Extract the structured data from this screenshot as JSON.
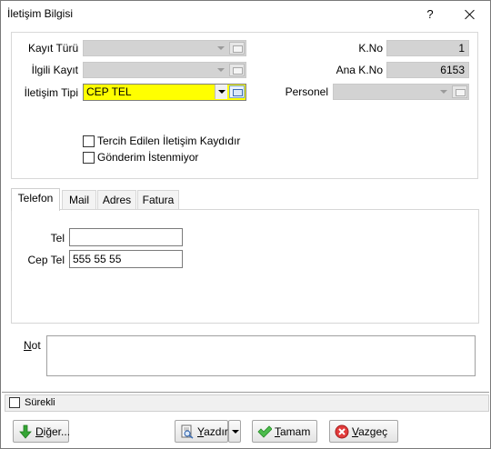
{
  "window": {
    "title": "İletişim Bilgisi",
    "help": "?"
  },
  "form": {
    "kayit_turu_label": "Kayıt Türü",
    "ilgili_kayit_label": "İlgili Kayıt",
    "iletisim_tipi_label": "İletişim Tipi",
    "iletisim_tipi_value": "CEP TEL",
    "kno_label": "K.No",
    "kno_value": "1",
    "ana_kno_label": "Ana K.No",
    "ana_kno_value": "6153",
    "personel_label": "Personel",
    "tercih_label": "Tercih Edilen İletişim Kaydıdır",
    "gonderim_label": "Gönderim İstenmiyor"
  },
  "tabs": [
    {
      "label": "Telefon"
    },
    {
      "label": "Mail"
    },
    {
      "label": "Adres"
    },
    {
      "label": "Fatura"
    }
  ],
  "phone": {
    "tel_label": "Tel",
    "tel_value": "",
    "cep_tel_label": "Cep Tel",
    "cep_tel_value": "555 55 55"
  },
  "note": {
    "label": "Not",
    "value": ""
  },
  "footer": {
    "surekli_label": "Sürekli",
    "diger_label": "Diğer...",
    "yazdir_label": "Yazdır",
    "tamam_label": "Tamam",
    "vazgec_label": "Vazgeç"
  },
  "colors": {
    "highlight_combo": "#ffff00",
    "disabled_field": "#d3d3d3"
  }
}
